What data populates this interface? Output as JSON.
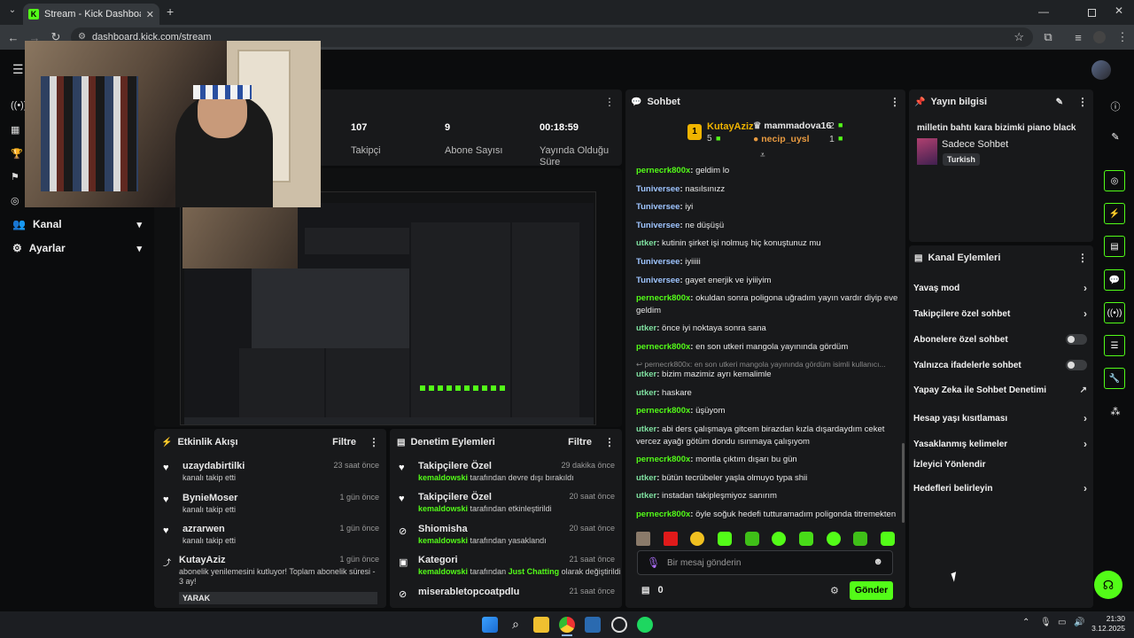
{
  "browser": {
    "tab_title": "Stream - Kick Dashboard",
    "url": "dashboard.kick.com/stream"
  },
  "sidebar": {
    "sections": [
      {
        "label": "Kanal"
      },
      {
        "label": "Ayarlar"
      }
    ]
  },
  "stats": [
    {
      "value": "107",
      "label": "Takipçi"
    },
    {
      "value": "9",
      "label": "Abone Sayısı"
    },
    {
      "value": "00:18:59",
      "label": "Yayında Olduğu Süre"
    }
  ],
  "activity": {
    "title": "Etkinlik Akışı",
    "filter_label": "Filtre",
    "items": [
      {
        "name": "uzaydabirtilki",
        "time": "23 saat önce",
        "action": "kanalı takip etti"
      },
      {
        "name": "BynieMoser",
        "time": "1 gün önce",
        "action": "kanalı takip etti"
      },
      {
        "name": "azrarwen",
        "time": "1 gün önce",
        "action": "kanalı takip etti"
      },
      {
        "name": "KutayAziz",
        "time": "1 gün önce",
        "action": "abonelik yenilemesini kutluyor! Toplam abonelik süresi - 3 ay!",
        "count": "3",
        "extra": "YARAK"
      }
    ]
  },
  "moderation": {
    "title": "Denetim Eylemleri",
    "filter_label": "Filtre",
    "items": [
      {
        "title": "Takipçilere Özel",
        "time": "29 dakika önce",
        "actor": "kemaldowski",
        "detail": "tarafından devre dışı bırakıldı"
      },
      {
        "title": "Takipçilere Özel",
        "time": "20 saat önce",
        "actor": "kemaldowski",
        "detail": "tarafından etkinleştirildi"
      },
      {
        "title": "Shiomisha",
        "time": "20 saat önce",
        "actor": "kemaldowski",
        "detail": "tarafından yasaklandı"
      },
      {
        "title": "Kategori",
        "time": "21 saat önce",
        "actor": "kemaldowski",
        "detail_pre": "tarafından",
        "category": "Just Chatting",
        "detail_post": "olarak değiştirildi"
      },
      {
        "title": "miserabletopcoatpdlu",
        "time": "21 saat önce"
      }
    ]
  },
  "chat": {
    "title": "Sohbet",
    "leaderboard": [
      {
        "rank": "1",
        "name": "KutayAziz",
        "count": "5"
      },
      {
        "name": "mammadova16",
        "count": "2"
      },
      {
        "name": "necip_uysl",
        "count": "1"
      }
    ],
    "messages": [
      {
        "user": "pernecrk800x",
        "text": "geldim lo"
      },
      {
        "user": "Tuniversee",
        "text": "nasılsınızz"
      },
      {
        "user": "Tuniversee",
        "text": "iyi"
      },
      {
        "user": "Tuniversee",
        "text": "ne düşüşü"
      },
      {
        "user": "utker",
        "text": "kutinin şirket işi nolmuş hiç konuştunuz mu"
      },
      {
        "user": "Tuniversee",
        "text": "iyiiiii"
      },
      {
        "user": "Tuniversee",
        "text": "gayet enerjik ve iyiiiyim"
      },
      {
        "user": "pernecrk800x",
        "text": "okuldan sonra poligona uğradım yayın vardır diyip eve geldim"
      },
      {
        "user": "utker",
        "text": "önce iyi noktaya sonra sana"
      },
      {
        "user": "pernecrk800x",
        "text": "en son utkeri mangola yayınında gördüm"
      },
      {
        "reply": "pernecrk800x: en son utkeri mangola yayınında gördüm isimli kullanıcı...",
        "user": "utker",
        "text": "bizim mazimiz ayrı kemalimle"
      },
      {
        "user": "utker",
        "text": "haskare"
      },
      {
        "user": "pernecrk800x",
        "text": "üşüyom"
      },
      {
        "user": "utker",
        "text": "abi ders çalışmaya gitcem birazdan kızla dışardaydım ceket vercez ayağı götüm dondu ısınmaya çalışıyom"
      },
      {
        "user": "pernecrk800x",
        "text": "montla çıktım dışarı bu gün"
      },
      {
        "user": "utker",
        "text": "bütün tecrübeler yaşla olmuyo typa shii"
      },
      {
        "user": "utker",
        "text": "instadan takipleşmiyoz sanırım"
      },
      {
        "user": "pernecrk800x",
        "text": "öyle soğuk hedefi tutturamadım poligonda titremekten"
      }
    ],
    "input_placeholder": "Bir mesaj gönderin",
    "points": "0",
    "send_label": "Gönder"
  },
  "stream_info": {
    "title": "Yayın bilgisi",
    "stream_title": "milletin bahtı kara bizimki piano black",
    "category": "Sadece Sohbet",
    "language": "Turkish"
  },
  "channel_actions": {
    "title": "Kanal Eylemleri",
    "items": [
      {
        "label": "Yavaş mod",
        "control": "chevron"
      },
      {
        "label": "Takipçilere özel sohbet",
        "control": "chevron"
      },
      {
        "label": "Abonelere özel sohbet",
        "control": "toggle"
      },
      {
        "label": "Yalnızca ifadelerle sohbet",
        "control": "toggle"
      },
      {
        "label": "Yapay Zeka ile Sohbet Denetimi",
        "control": "external"
      },
      {
        "label": "Hesap yaşı kısıtlaması",
        "control": "chevron"
      },
      {
        "label": "Yasaklanmış kelimeler",
        "control": "chevron"
      },
      {
        "label": "İzleyici Yönlendir",
        "control": "none"
      },
      {
        "label": "Hedefleri belirleyin",
        "control": "chevron"
      }
    ]
  },
  "taskbar": {
    "time": "21:30",
    "date": "3.12.2025"
  },
  "colors": {
    "accent": "#53fc18",
    "panel": "#18191b",
    "background": "#0b0c0d"
  }
}
